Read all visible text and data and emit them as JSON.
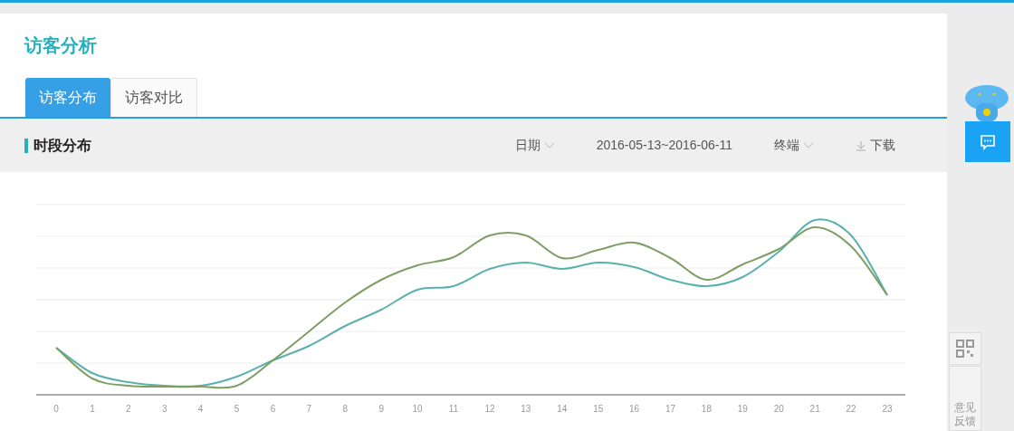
{
  "page_title": "访客分析",
  "tabs": [
    {
      "label": "访客分布",
      "selected": true
    },
    {
      "label": "访客对比",
      "selected": false
    }
  ],
  "section": {
    "title": "时段分布",
    "filters": [
      {
        "kind": "dropdown",
        "label": "日期"
      },
      {
        "kind": "text",
        "label": "2016-05-13~2016-06-11"
      },
      {
        "kind": "dropdown",
        "label": "终端"
      },
      {
        "kind": "download",
        "label": "下载"
      }
    ]
  },
  "chart": {
    "x_labels": [
      "0",
      "1",
      "2",
      "3",
      "4",
      "5",
      "6",
      "7",
      "8",
      "9",
      "10",
      "11",
      "12",
      "13",
      "14",
      "15",
      "16",
      "17",
      "18",
      "19",
      "20",
      "21",
      "22",
      "23"
    ]
  },
  "sidebar": {
    "feedback_label": "意见反馈"
  }
}
